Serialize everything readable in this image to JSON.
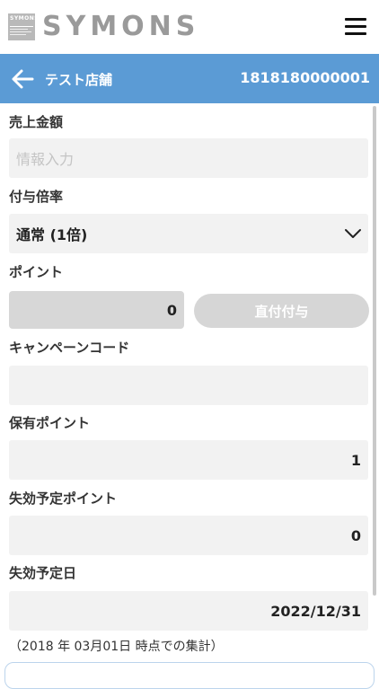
{
  "header": {
    "logo_mark_text": "SYMONS",
    "brand": "SYMONS"
  },
  "titlebar": {
    "store_name": "テスト店舗",
    "card_number": "1818180000001"
  },
  "form": {
    "sales_amount": {
      "label": "売上金額",
      "placeholder": "情報入力"
    },
    "multiplier": {
      "label": "付与倍率",
      "selected": "通常 (1倍)"
    },
    "points": {
      "label": "ポイント",
      "value": "0",
      "grant_button": "直付付与"
    },
    "campaign_code": {
      "label": "キャンペーンコード",
      "value": ""
    },
    "held_points": {
      "label": "保有ポイント",
      "value": "1"
    },
    "expiring_points": {
      "label": "失効予定ポイント",
      "value": "0"
    },
    "expiry_date": {
      "label": "失効予定日",
      "value": "2022/12/31"
    },
    "note": "（2018 年 03月01日  時点での集計）"
  },
  "icons": {
    "menu": "hamburger-menu-icon",
    "back": "arrow-left-icon",
    "select": "chevron-down-icon"
  },
  "colors": {
    "titlebar": "#5b9bd5",
    "field_bg": "#f2f2f2",
    "button_disabled": "#d6d6d6"
  }
}
